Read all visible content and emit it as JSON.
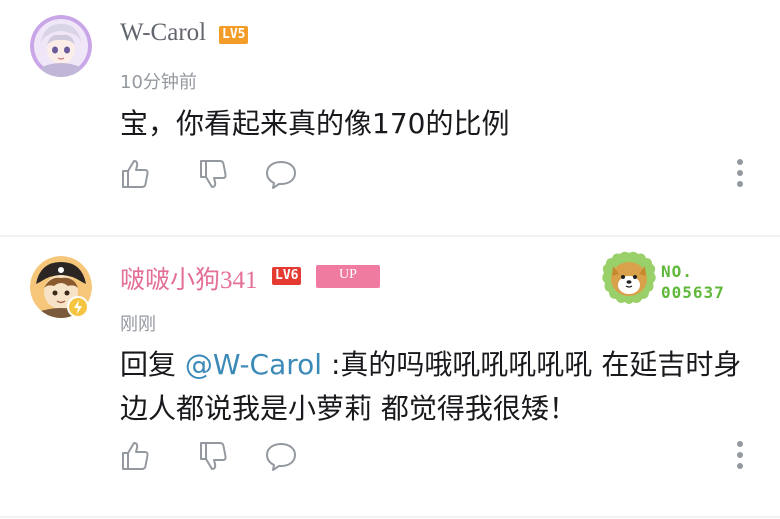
{
  "comments": [
    {
      "username": "W-Carol",
      "level": "LV5",
      "time": "10分钟前",
      "text": "宝，你看起来真的像170的比例"
    },
    {
      "username": "啵啵小狗341",
      "level": "LV6",
      "up_label": "UP",
      "time": "刚刚",
      "reply_prefix": "回复 ",
      "mention": "@W-Carol",
      "text": " :真的吗哦吼吼吼吼吼 在延吉时身边人都说我是小萝莉 都觉得我很矮！",
      "badge": {
        "line1": "NO.",
        "line2": "005637"
      }
    }
  ],
  "icons": {
    "like": "thumbs-up-icon",
    "dislike": "thumbs-down-icon",
    "reply": "comment-bubble-icon",
    "more": "more-vertical-icon"
  },
  "colors": {
    "username_gray": "#61666d",
    "username_pink": "#e36f95",
    "mention_blue": "#3c8ab8",
    "lv5": "#f39c27",
    "lv6": "#e53a32",
    "up_tag": "#f07ba0",
    "badge_green": "#5fb83a"
  }
}
